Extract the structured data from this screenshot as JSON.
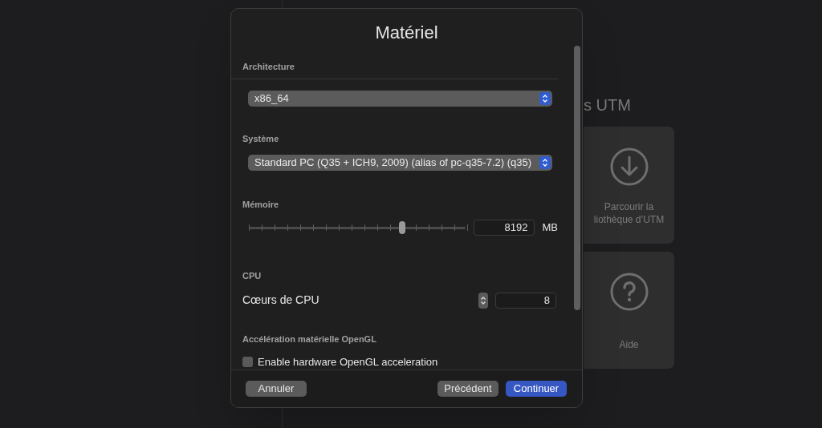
{
  "background": {
    "title": "s UTM",
    "cards": [
      {
        "kind": "download",
        "label": "Parcourir la\nliothèque d’UTM"
      },
      {
        "kind": "help",
        "label": "Aide"
      }
    ]
  },
  "dialog": {
    "title": "Matériel",
    "architecture": {
      "heading": "Architecture",
      "value": "x86_64"
    },
    "system": {
      "heading": "Système",
      "value": "Standard PC (Q35 + ICH9, 2009) (alias of pc-q35-7.2) (q35)"
    },
    "memory": {
      "heading": "Mémoire",
      "level": 0.7,
      "value": "8192",
      "unit": "MB"
    },
    "cpu": {
      "heading": "CPU",
      "label": "Cœurs de CPU",
      "value": "8"
    },
    "opengl": {
      "heading": "Accélération matérielle OpenGL",
      "label": "Enable hardware OpenGL acceleration",
      "checked": false
    },
    "buttons": [
      {
        "label": "Annuler",
        "kind": "secondary"
      },
      {
        "label": "Précédent",
        "kind": "secondary"
      },
      {
        "label": "Continuer",
        "kind": "primary"
      }
    ]
  }
}
